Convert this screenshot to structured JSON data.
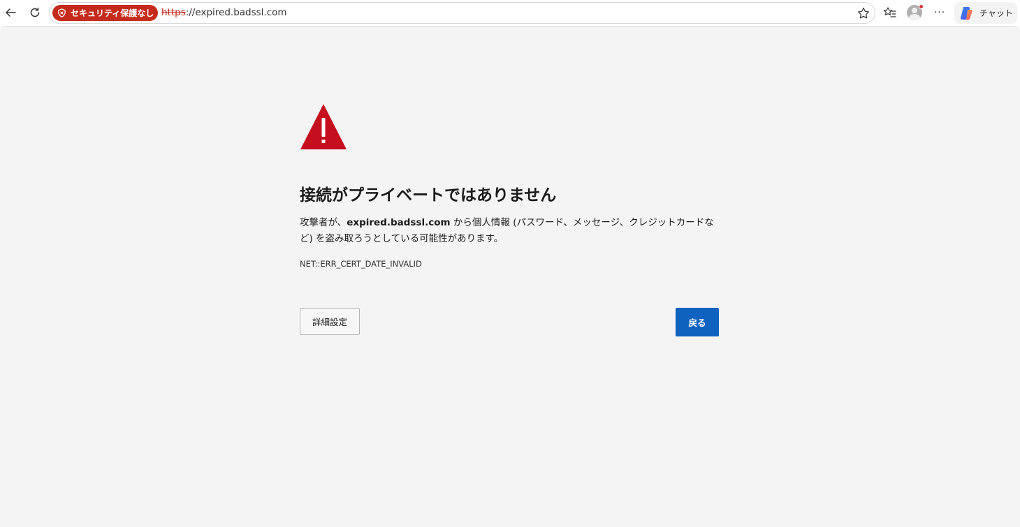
{
  "toolbar": {
    "security_badge": "セキュリティ保護なし",
    "url_scheme": "https",
    "url_rest": "://expired.badssl.com",
    "chat_label": "チャット",
    "more_label": "···"
  },
  "error": {
    "title": "接続がプライベートではありません",
    "desc_prefix": "攻撃者が、",
    "desc_host": "expired.badssl.com",
    "desc_suffix": " から個人情報 (パスワード、メッセージ、クレジットカードなど) を盗み取ろうとしている可能性があります。",
    "code": "NET::ERR_CERT_DATE_INVALID",
    "advanced_label": "詳細設定",
    "back_label": "戻る"
  },
  "colors": {
    "badge": "#c42b1c",
    "primary_button": "#0f62be",
    "warning": "#c50f1f",
    "page_background": "#f4f4f4"
  },
  "icons": [
    "back-arrow-icon",
    "reload-icon",
    "shield-icon",
    "star-icon",
    "favorites-icon",
    "avatar-icon",
    "more-icon",
    "copilot-icon",
    "warning-triangle-icon"
  ]
}
